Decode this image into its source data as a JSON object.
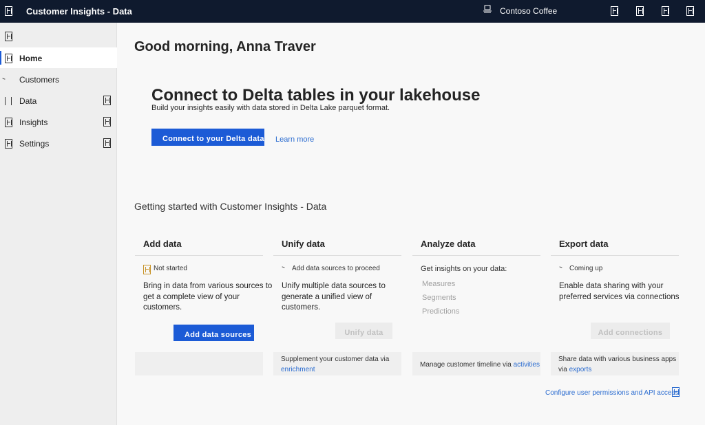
{
  "header": {
    "app_title": "Customer Insights - Data",
    "environment": "Contoso Coffee",
    "icons": [
      "settings-icon",
      "help-icon",
      "feedback-icon",
      "account-icon"
    ]
  },
  "sidebar": {
    "items": [
      {
        "label": "Home",
        "icon": "home-icon",
        "active": true
      },
      {
        "label": "Customers",
        "icon": "customers-icon"
      },
      {
        "label": "Data",
        "icon": "data-icon",
        "expandable": true
      },
      {
        "label": "Insights",
        "icon": "insights-icon",
        "expandable": true
      },
      {
        "label": "Settings",
        "icon": "settings-icon",
        "expandable": true
      }
    ]
  },
  "main": {
    "greeting": "Good morning, Anna Traver",
    "hero": {
      "title": "Connect to Delta tables in your lakehouse",
      "subtitle": "Build your insights easily with data stored in Delta Lake parquet format.",
      "button": "Connect to your Delta data",
      "link": "Learn more"
    },
    "section_title": "Getting started with Customer Insights - Data",
    "cards": {
      "add_data": {
        "title": "Add data",
        "status": "Not started",
        "description": "Bring in data from various sources to get a complete view of your customers.",
        "button": "Add data sources"
      },
      "unify_data": {
        "title": "Unify data",
        "status": "Add data sources to proceed",
        "description": "Unify multiple data sources to generate a unified view of customers.",
        "button": "Unify data",
        "footer_text": "Supplement your customer data via",
        "footer_link": "enrichment"
      },
      "analyze_data": {
        "title": "Analyze data",
        "description": "Get insights on your data:",
        "items": [
          "Measures",
          "Segments",
          "Predictions"
        ],
        "footer_text": "Manage customer timeline via",
        "footer_link": "activities"
      },
      "export_data": {
        "title": "Export data",
        "status": "Coming up",
        "description": "Enable data sharing with your preferred services via connections",
        "button": "Add connections",
        "footer_text": "Share data with various business apps via",
        "footer_link": "exports"
      }
    },
    "config_link": "Configure user permissions and API access"
  }
}
